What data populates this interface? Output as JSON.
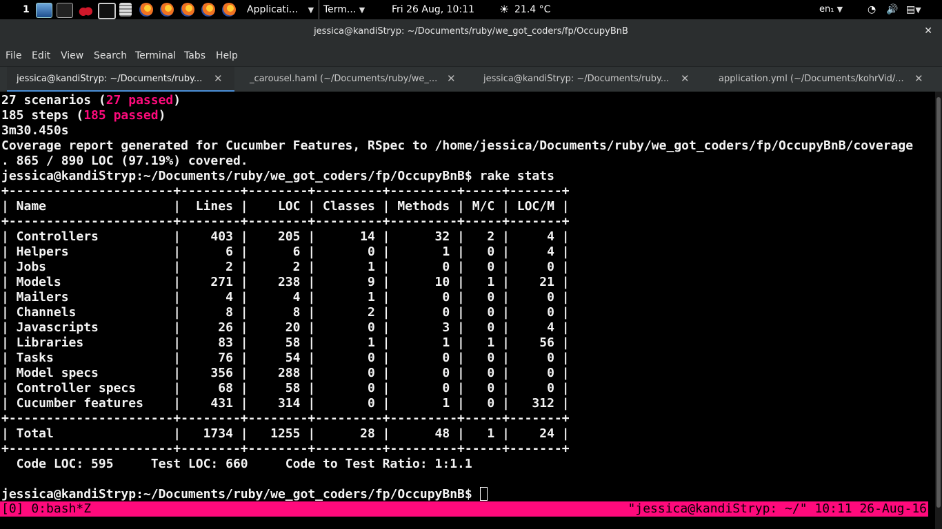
{
  "panel": {
    "workspace": "1",
    "app_menu": "Applicati...",
    "task": "Term...",
    "clock": "Fri 26 Aug, 10:11",
    "weather": "21.4 °C",
    "keyboard": "en₁"
  },
  "window": {
    "title": "jessica@kandiStryp: ~/Documents/ruby/we_got_coders/fp/OccupyBnB",
    "close": "✕"
  },
  "menu": [
    "File",
    "Edit",
    "View",
    "Search",
    "Terminal",
    "Tabs",
    "Help"
  ],
  "tabs": [
    {
      "label": "jessica@kandiStryp: ~/Documents/ruby..."
    },
    {
      "label": "_carousel.haml (~/Documents/ruby/we_..."
    },
    {
      "label": "jessica@kandiStryp: ~/Documents/ruby..."
    },
    {
      "label": "application.yml (~/Documents/kohrVid/..."
    }
  ],
  "terminal": {
    "scenarios": {
      "count": "27 scenarios",
      "passed": "27 passed"
    },
    "steps": {
      "count": "185 steps",
      "passed": "185 passed"
    },
    "duration": "3m30.450s",
    "coverage_line1": "Coverage report generated for Cucumber Features, RSpec to /home/jessica/Documents/ruby/we_got_coders/fp/OccupyBnB/coverage",
    "coverage_line2": ". 865 / 890 LOC (97.19%) covered.",
    "prompt": "jessica@kandiStryp:~/Documents/ruby/we_got_coders/fp/OccupyBnB$",
    "command": "rake stats",
    "table": {
      "headers": [
        "Name",
        "Lines",
        "LOC",
        "Classes",
        "Methods",
        "M/C",
        "LOC/M"
      ],
      "rows": [
        [
          "Controllers",
          "403",
          "205",
          "14",
          "32",
          "2",
          "4"
        ],
        [
          "Helpers",
          "6",
          "6",
          "0",
          "1",
          "0",
          "4"
        ],
        [
          "Jobs",
          "2",
          "2",
          "1",
          "0",
          "0",
          "0"
        ],
        [
          "Models",
          "271",
          "238",
          "9",
          "10",
          "1",
          "21"
        ],
        [
          "Mailers",
          "4",
          "4",
          "1",
          "0",
          "0",
          "0"
        ],
        [
          "Channels",
          "8",
          "8",
          "2",
          "0",
          "0",
          "0"
        ],
        [
          "Javascripts",
          "26",
          "20",
          "0",
          "3",
          "0",
          "4"
        ],
        [
          "Libraries",
          "83",
          "58",
          "1",
          "1",
          "1",
          "56"
        ],
        [
          "Tasks",
          "76",
          "54",
          "0",
          "0",
          "0",
          "0"
        ],
        [
          "Model specs",
          "356",
          "288",
          "0",
          "0",
          "0",
          "0"
        ],
        [
          "Controller specs",
          "68",
          "58",
          "0",
          "0",
          "0",
          "0"
        ],
        [
          "Cucumber features",
          "431",
          "314",
          "0",
          "1",
          "0",
          "312"
        ]
      ],
      "total": [
        "Total",
        "1734",
        "1255",
        "28",
        "48",
        "1",
        "24"
      ]
    },
    "summary": {
      "code_loc": "595",
      "test_loc": "660",
      "ratio": "1:1.1"
    }
  },
  "tmux": {
    "left": "[0] 0:bash*Z",
    "right": "\"jessica@kandiStryp: ~/\" 10:11 26-Aug-16"
  }
}
